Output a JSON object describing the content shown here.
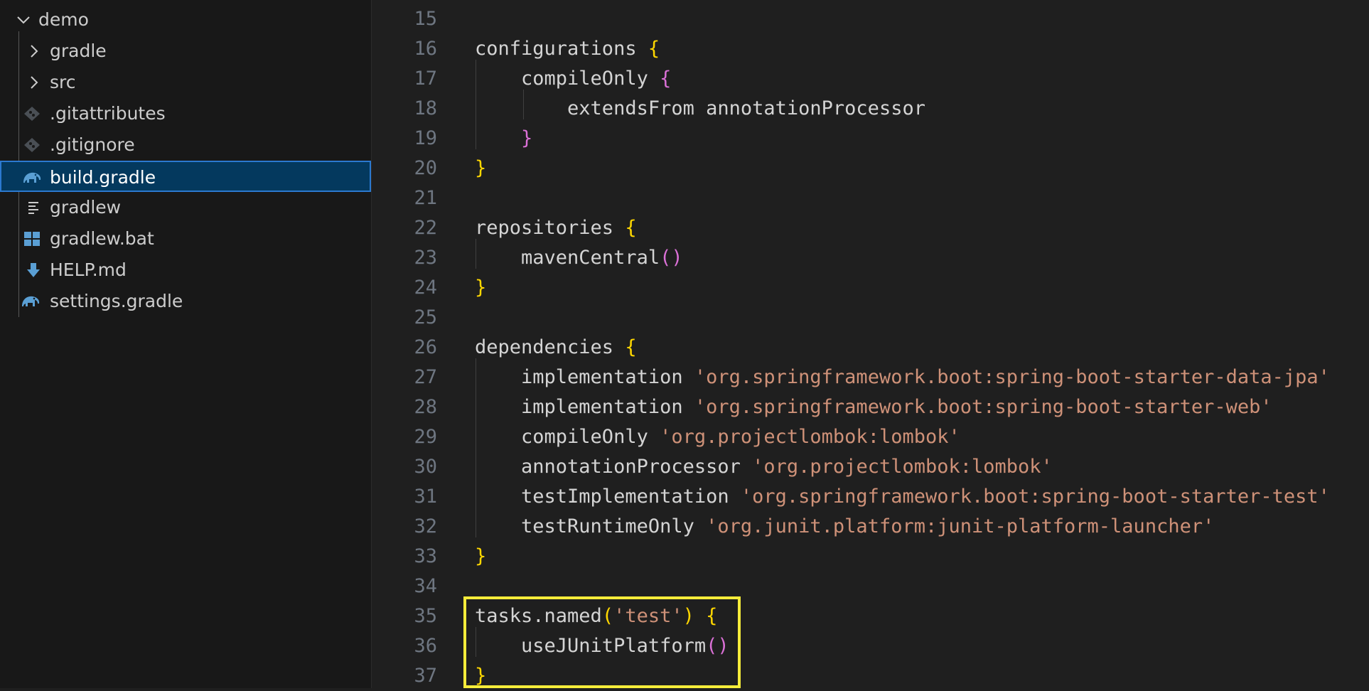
{
  "explorer": {
    "root": {
      "label": "demo",
      "expanded": true,
      "icon": "chevron-down"
    },
    "items": [
      {
        "label": "gradle",
        "kind": "folder",
        "icon": "chevron-right"
      },
      {
        "label": "src",
        "kind": "folder",
        "icon": "chevron-right"
      },
      {
        "label": ".gitattributes",
        "kind": "file",
        "icon": "git-icon"
      },
      {
        "label": ".gitignore",
        "kind": "file",
        "icon": "git-icon"
      },
      {
        "label": "build.gradle",
        "kind": "file",
        "icon": "gradle-elephant-icon",
        "selected": true
      },
      {
        "label": "gradlew",
        "kind": "file",
        "icon": "text-file-icon"
      },
      {
        "label": "gradlew.bat",
        "kind": "file",
        "icon": "windows-icon"
      },
      {
        "label": "HELP.md",
        "kind": "file",
        "icon": "markdown-download-icon"
      },
      {
        "label": "settings.gradle",
        "kind": "file",
        "icon": "gradle-elephant-icon"
      }
    ]
  },
  "editor": {
    "lines": [
      {
        "n": "15",
        "tokens": []
      },
      {
        "n": "16",
        "tokens": [
          {
            "t": "configurations "
          },
          {
            "t": "{",
            "c": "b1"
          }
        ]
      },
      {
        "n": "17",
        "tokens": [
          {
            "t": "    compileOnly "
          },
          {
            "t": "{",
            "c": "b2"
          }
        ]
      },
      {
        "n": "18",
        "tokens": [
          {
            "t": "        extendsFrom annotationProcessor"
          }
        ]
      },
      {
        "n": "19",
        "tokens": [
          {
            "t": "    "
          },
          {
            "t": "}",
            "c": "b2"
          }
        ]
      },
      {
        "n": "20",
        "tokens": [
          {
            "t": "}",
            "c": "b1"
          }
        ]
      },
      {
        "n": "21",
        "tokens": []
      },
      {
        "n": "22",
        "tokens": [
          {
            "t": "repositories "
          },
          {
            "t": "{",
            "c": "b1"
          }
        ]
      },
      {
        "n": "23",
        "tokens": [
          {
            "t": "    mavenCentral"
          },
          {
            "t": "()",
            "c": "b2"
          }
        ]
      },
      {
        "n": "24",
        "tokens": [
          {
            "t": "}",
            "c": "b1"
          }
        ]
      },
      {
        "n": "25",
        "tokens": []
      },
      {
        "n": "26",
        "tokens": [
          {
            "t": "dependencies "
          },
          {
            "t": "{",
            "c": "b1"
          }
        ]
      },
      {
        "n": "27",
        "tokens": [
          {
            "t": "    implementation "
          },
          {
            "t": "'org.springframework.boot:spring-boot-starter-data-jpa'",
            "c": "str"
          }
        ]
      },
      {
        "n": "28",
        "tokens": [
          {
            "t": "    implementation "
          },
          {
            "t": "'org.springframework.boot:spring-boot-starter-web'",
            "c": "str"
          }
        ]
      },
      {
        "n": "29",
        "tokens": [
          {
            "t": "    compileOnly "
          },
          {
            "t": "'org.projectlombok:lombok'",
            "c": "str"
          }
        ]
      },
      {
        "n": "30",
        "tokens": [
          {
            "t": "    annotationProcessor "
          },
          {
            "t": "'org.projectlombok:lombok'",
            "c": "str"
          }
        ]
      },
      {
        "n": "31",
        "tokens": [
          {
            "t": "    testImplementation "
          },
          {
            "t": "'org.springframework.boot:spring-boot-starter-test'",
            "c": "str"
          }
        ]
      },
      {
        "n": "32",
        "tokens": [
          {
            "t": "    testRuntimeOnly "
          },
          {
            "t": "'org.junit.platform:junit-platform-launcher'",
            "c": "str"
          }
        ]
      },
      {
        "n": "33",
        "tokens": [
          {
            "t": "}",
            "c": "b1"
          }
        ]
      },
      {
        "n": "34",
        "tokens": []
      },
      {
        "n": "35",
        "tokens": [
          {
            "t": "tasks.named"
          },
          {
            "t": "(",
            "c": "b1"
          },
          {
            "t": "'test'",
            "c": "str"
          },
          {
            "t": ")",
            "c": "b1"
          },
          {
            "t": " "
          },
          {
            "t": "{",
            "c": "b1"
          }
        ]
      },
      {
        "n": "36",
        "tokens": [
          {
            "t": "    useJUnitPlatform"
          },
          {
            "t": "()",
            "c": "b2"
          }
        ]
      },
      {
        "n": "37",
        "tokens": [
          {
            "t": "}",
            "c": "b1"
          }
        ]
      }
    ]
  },
  "colors": {
    "sidebar_bg": "#181818",
    "editor_bg": "#1f1f1f",
    "selection_bg": "#04395e",
    "selection_border": "#2b79d0",
    "string": "#ce9178",
    "bracket_level1": "#ffd700",
    "bracket_level2": "#da70d6",
    "highlight_box": "#f5ec3a",
    "icon_blue": "#5a9fd4"
  }
}
